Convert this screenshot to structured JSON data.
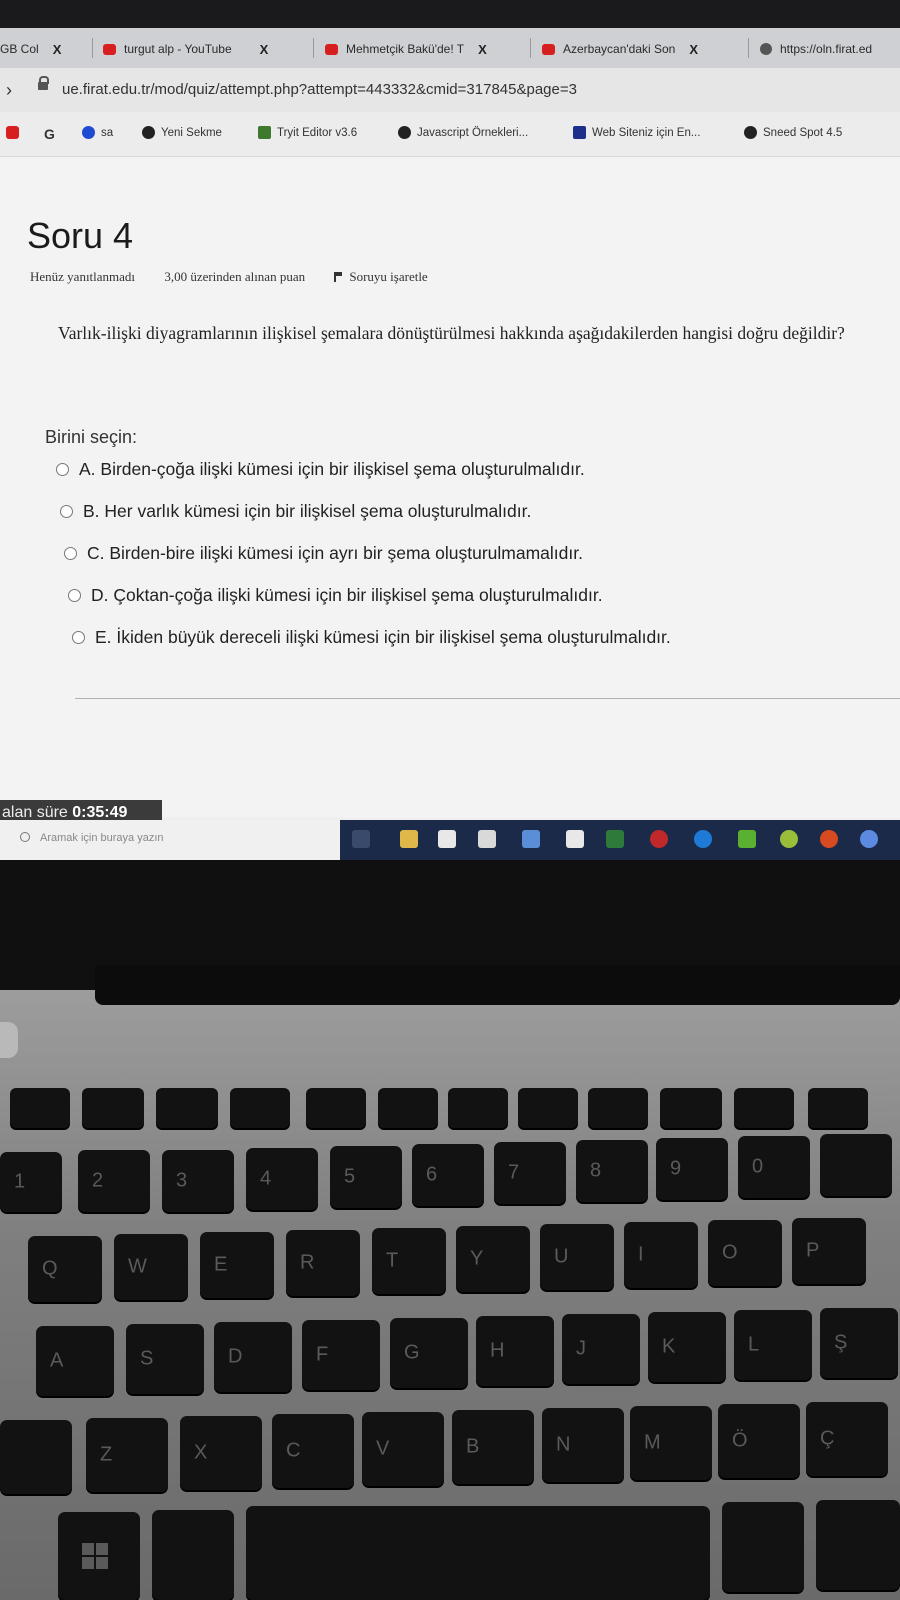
{
  "browser": {
    "tabs": [
      {
        "label": "GB Col",
        "icon": "tab-icon",
        "close": "X"
      },
      {
        "label": "turgut alp - YouTube",
        "icon": "youtube-icon",
        "close": "X"
      },
      {
        "label": "Mehmetçik Bakü'de! T",
        "icon": "youtube-icon",
        "close": "X"
      },
      {
        "label": "Azerbaycan'daki Son",
        "icon": "youtube-icon",
        "close": "X"
      },
      {
        "label": "https://oln.firat.ed",
        "icon": "globe-icon",
        "close": ""
      }
    ],
    "url": "ue.firat.edu.tr/mod/quiz/attempt.php?attempt=443332&cmid=317845&page=3",
    "bookmarks": [
      {
        "label": "",
        "icon": "youtube-icon"
      },
      {
        "label": "G",
        "icon": "google-icon"
      },
      {
        "label": "sa",
        "icon": "history-icon"
      },
      {
        "label": "Yeni Sekme",
        "icon": "globe-icon"
      },
      {
        "label": "Tryit Editor v3.6",
        "icon": "w3schools-icon"
      },
      {
        "label": "Javascript Örnekleri...",
        "icon": "wordpress-icon"
      },
      {
        "label": "Web Siteniz için En...",
        "icon": "n-icon"
      },
      {
        "label": "Sneed Spot 4.5",
        "icon": "globe-icon"
      }
    ]
  },
  "quiz": {
    "title": "Soru 4",
    "status": "Henüz yanıtlanmadı",
    "points": "3,00 üzerinden alınan puan",
    "flag_label": "Soruyu işaretle",
    "question": "Varlık-ilişki diyagramlarının ilişkisel şemalara dönüştürülmesi hakkında aşağıdakilerden hangisi doğru değildir?",
    "choose_label": "Birini seçin:",
    "options": [
      "A. Birden-çoğa ilişki kümesi için bir ilişkisel şema oluşturulmalıdır.",
      "B. Her varlık kümesi için bir ilişkisel şema oluşturulmalıdır.",
      "C. Birden-bire ilişki kümesi için ayrı bir şema oluşturulmamalıdır.",
      "D. Çoktan-çoğa ilişki kümesi için bir ilişkisel şema oluşturulmalıdır.",
      "E. İkiden büyük dereceli ilişki kümesi için bir ilişkisel şema oluşturulmalıdır."
    ]
  },
  "timer": {
    "label": "alan süre",
    "value": "0:35:49"
  },
  "taskbar": {
    "search_placeholder": "Aramak için buraya yazın"
  },
  "keyboard": {
    "row_numbers": [
      "1",
      "2",
      "3",
      "4",
      "5",
      "6",
      "7",
      "8",
      "9",
      "0"
    ],
    "row_top": [
      "Q",
      "W",
      "E",
      "R",
      "T",
      "Y",
      "U",
      "I",
      "O",
      "P"
    ],
    "row_home": [
      "A",
      "S",
      "D",
      "F",
      "G",
      "H",
      "J",
      "K",
      "L",
      "Ş"
    ],
    "row_bottom": [
      "Z",
      "X",
      "C",
      "V",
      "B",
      "N",
      "M",
      "Ö",
      "Ç"
    ]
  },
  "colors": {
    "youtube": "#d81f1f",
    "taskbar": "#1b2a48",
    "page_bg": "#f3f3f3"
  }
}
